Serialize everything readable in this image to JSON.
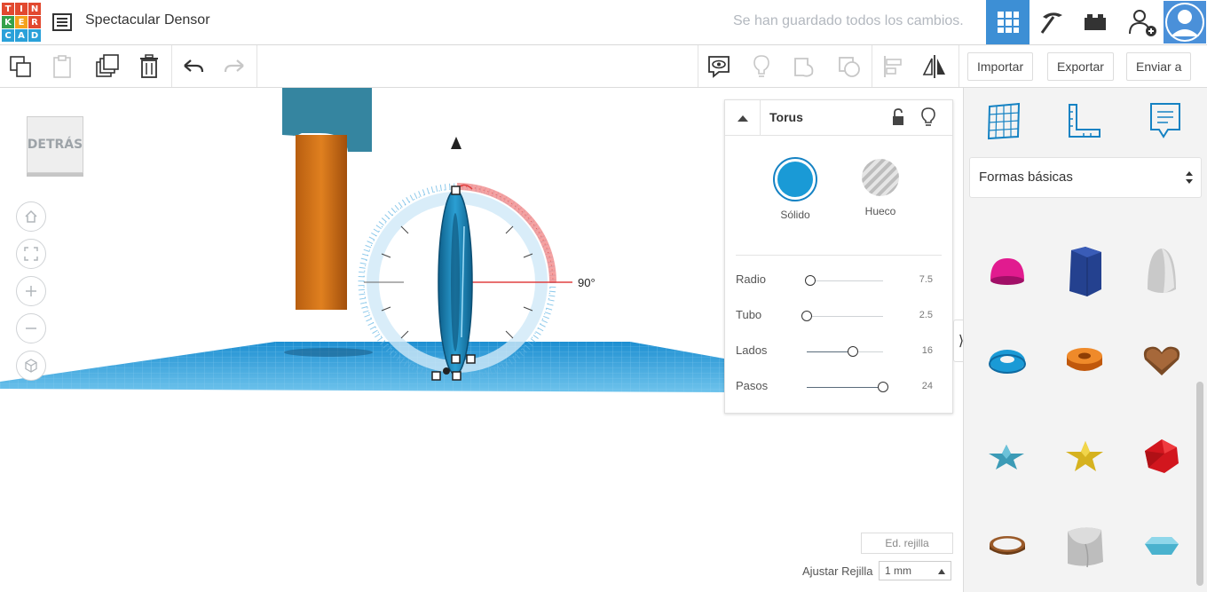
{
  "header": {
    "logo_letters": [
      "T",
      "I",
      "N",
      "K",
      "E",
      "R",
      "C",
      "A",
      "D"
    ],
    "logo_colors": [
      "#e2492f",
      "#e2492f",
      "#e2492f",
      "#35a24a",
      "#f4a21b",
      "#e2492f",
      "#2aa1d9",
      "#2aa1d9",
      "#2aa1d9"
    ],
    "title": "Spectacular Densor",
    "save_status": "Se han guardado todos los cambios.",
    "icons": [
      "list-icon",
      "grid-view-icon",
      "pickaxe-icon",
      "bricks-icon",
      "add-user-icon",
      "avatar"
    ]
  },
  "toolbar": {
    "import_label": "Importar",
    "export_label": "Exportar",
    "send_label": "Enviar a"
  },
  "viewcube": {
    "label": "DETRÁS"
  },
  "canvas": {
    "rotation_label": "90°"
  },
  "inspector": {
    "shape_name": "Torus",
    "solid_label": "Sólido",
    "hole_label": "Hueco",
    "params": [
      {
        "label": "Radio",
        "value": "7.5",
        "fraction": 0.05
      },
      {
        "label": "Tubo",
        "value": "2.5",
        "fraction": 0.0
      },
      {
        "label": "Lados",
        "value": "16",
        "fraction": 0.6
      },
      {
        "label": "Pasos",
        "value": "24",
        "fraction": 1.0
      }
    ],
    "colors": {
      "solid": "#1a9ad6",
      "accent": "#1582c3"
    }
  },
  "panel": {
    "category": "Formas básicas",
    "shapes": [
      "half-sphere",
      "polygon",
      "paraboloid",
      "torus",
      "tube",
      "heart",
      "star",
      "star-gold",
      "icosahedron",
      "ring",
      "rounded-roof",
      "diamond"
    ]
  },
  "footer": {
    "edit_grid_label": "Ed. rejilla",
    "snap_grid_label": "Ajustar Rejilla",
    "snap_grid_value": "1 mm"
  }
}
